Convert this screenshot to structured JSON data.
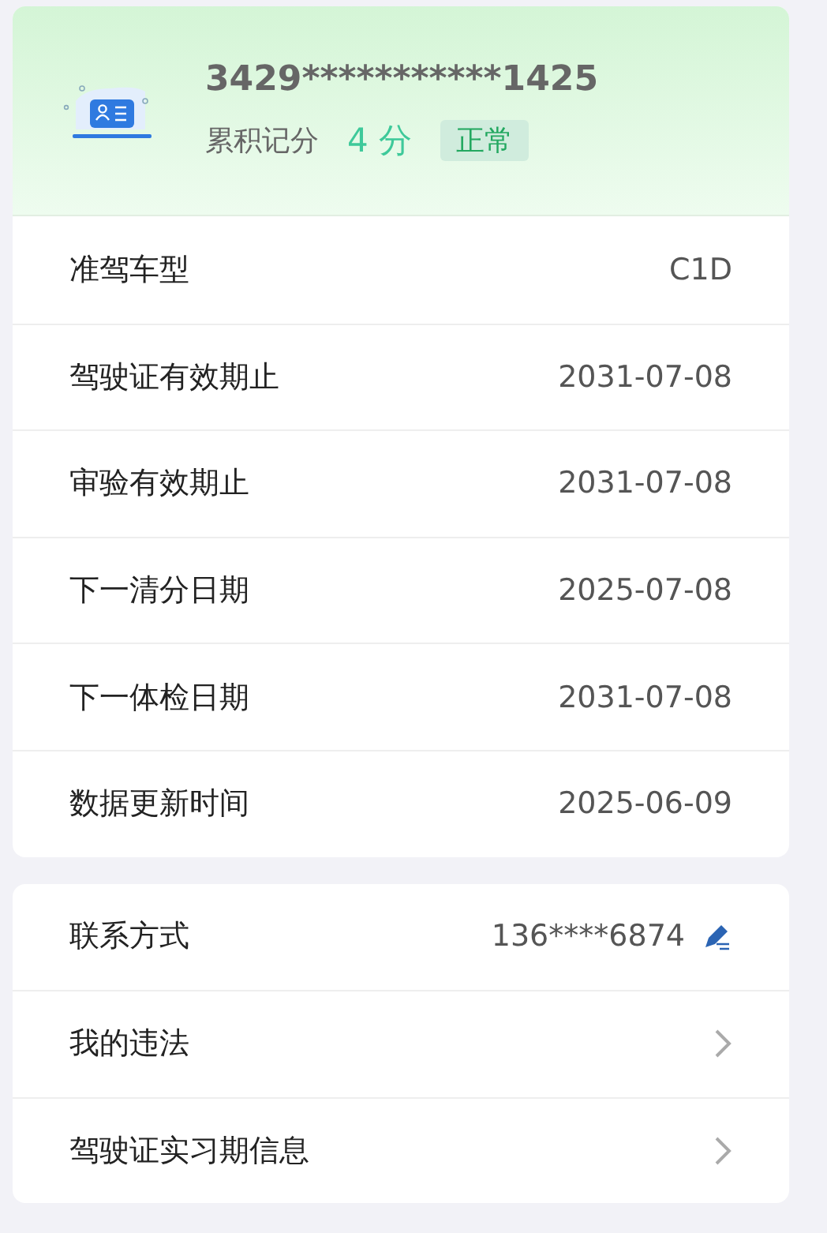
{
  "license": {
    "number": "3429***********1425",
    "points_label": "累积记分",
    "points": "4 分",
    "status": "正常"
  },
  "details": [
    {
      "label": "准驾车型",
      "value": "C1D"
    },
    {
      "label": "驾驶证有效期止",
      "value": "2031-07-08"
    },
    {
      "label": "审验有效期止",
      "value": "2031-07-08"
    },
    {
      "label": "下一清分日期",
      "value": "2025-07-08"
    },
    {
      "label": "下一体检日期",
      "value": "2031-07-08"
    },
    {
      "label": "数据更新时间",
      "value": "2025-06-09"
    }
  ],
  "links": [
    {
      "kind": "edit",
      "label": "联系方式",
      "value": "136****6874"
    },
    {
      "kind": "arrow",
      "label": "我的违法"
    },
    {
      "kind": "arrow",
      "label": "驾驶证实习期信息"
    }
  ]
}
